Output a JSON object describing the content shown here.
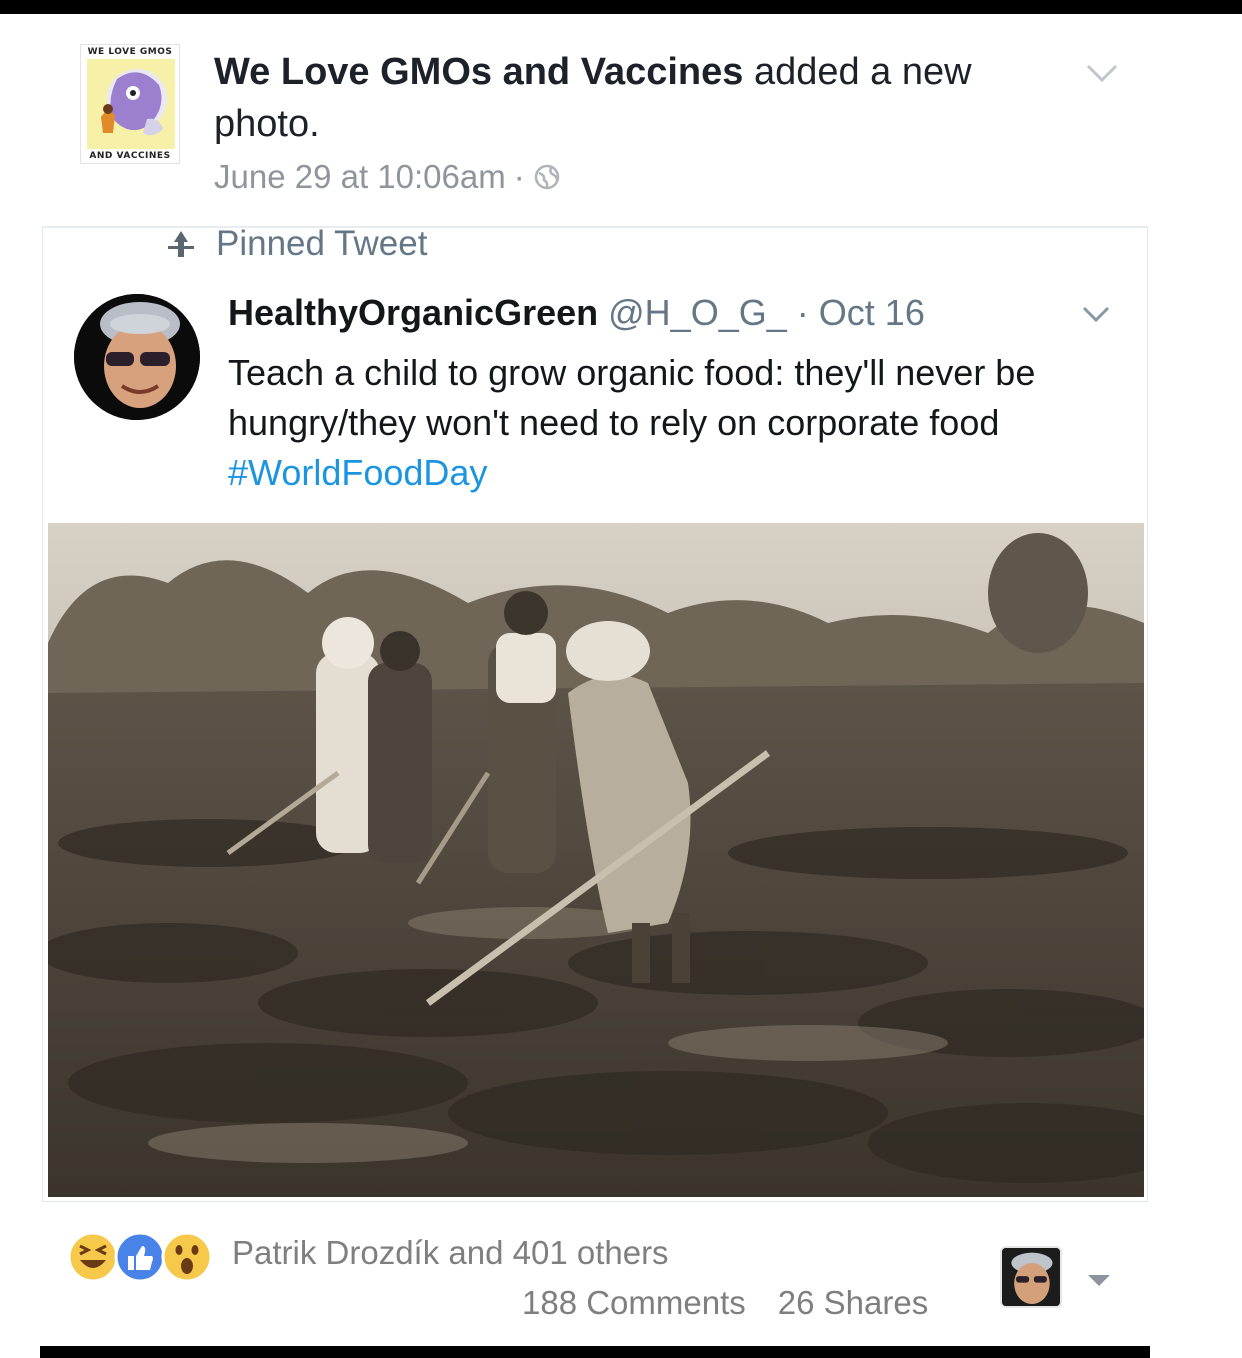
{
  "post": {
    "page_logo_caption_top": "WE LOVE GMOS",
    "page_logo_caption_bottom": "AND VACCINES",
    "page_name": "We Love GMOs and Vaccines",
    "action_text": " added a new photo.",
    "timestamp": "June 29 at 10:06am",
    "separator": "·",
    "privacy_icon": "globe-icon",
    "menu_icon": "chevron-down-icon"
  },
  "tweet": {
    "pinned_label": "Pinned Tweet",
    "pin_icon": "pin-icon",
    "author_name": "HealthyOrganicGreen",
    "handle": "@H_O_G_",
    "separator": "·",
    "date": "Oct 16",
    "text": "Teach a child to grow organic food: they'll never be hungry/they won't  need to rely on corporate food ",
    "hashtag": "#WorldFoodDay",
    "colors": {
      "hashtag": "#1b95e0",
      "muted": "#657786"
    }
  },
  "footer": {
    "reactions": [
      "haha-icon",
      "like-icon",
      "wow-icon"
    ],
    "reactors_text": "Patrik Drozdík and 401 others",
    "comments": "188 Comments",
    "shares": "26 Shares",
    "viewer_menu_icon": "caret-down-icon"
  }
}
